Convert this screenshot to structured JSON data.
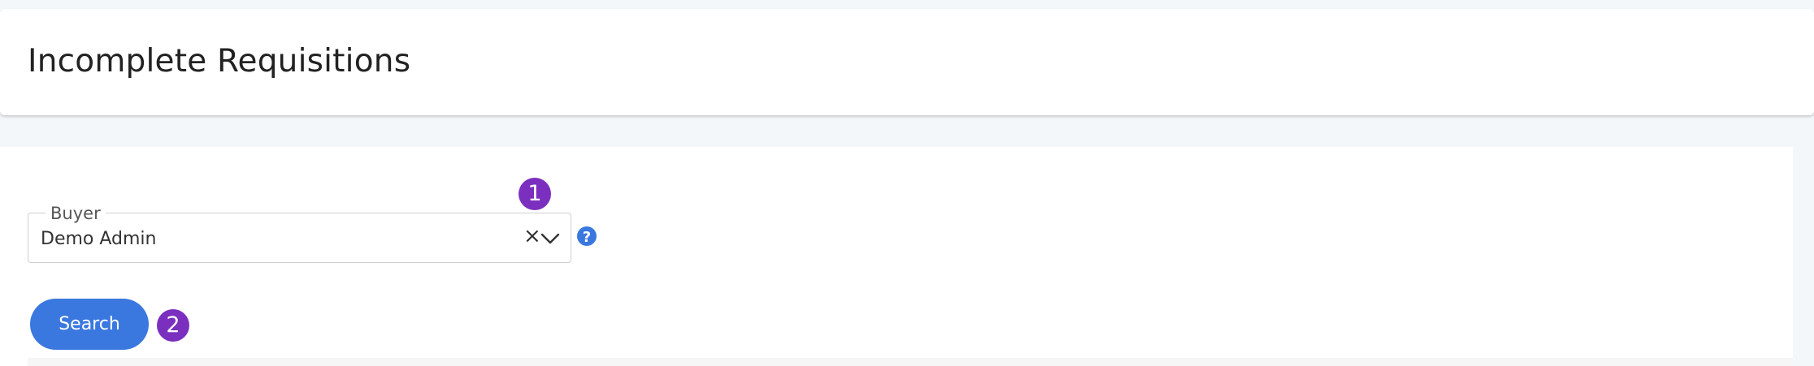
{
  "header": {
    "title": "Incomplete Requisitions"
  },
  "form": {
    "buyer": {
      "label": "Buyer",
      "value": "Demo Admin",
      "clear_glyph": "×",
      "help_glyph": "?"
    },
    "search_label": "Search"
  },
  "badges": {
    "step_1": "1",
    "step_2": "2"
  },
  "colors": {
    "accent": "#3a78e0",
    "badge": "#7b2fbf",
    "page_bg": "#f4f7fa"
  }
}
